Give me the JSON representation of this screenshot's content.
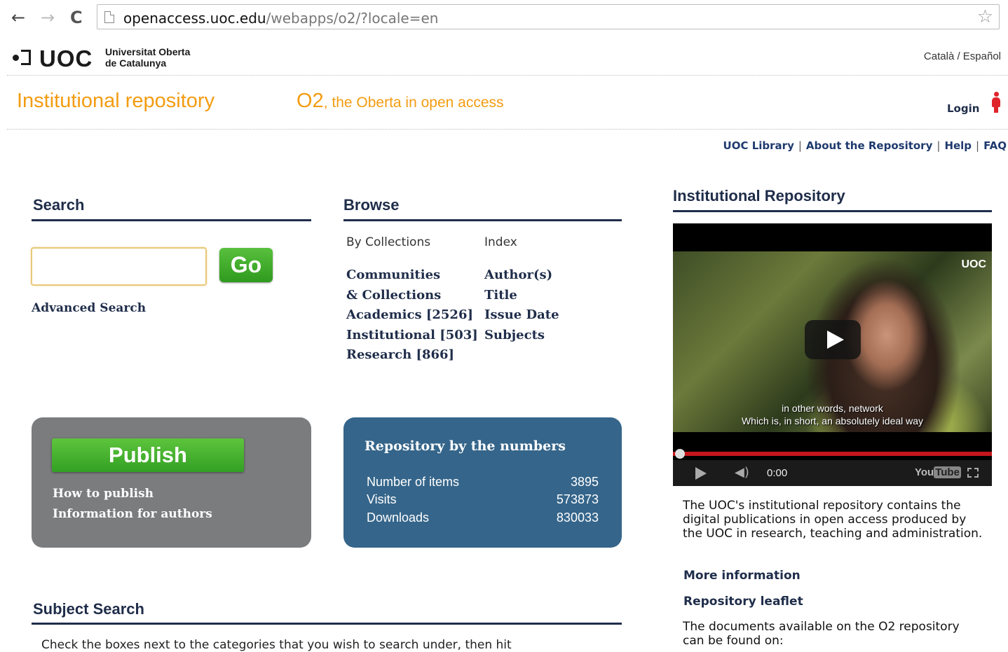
{
  "browser": {
    "url_host": "openaccess.uoc.edu",
    "url_path": "/webapps/o2/?locale=en",
    "back_glyph": "←",
    "forward_glyph": "→",
    "reload_glyph": "C",
    "star_glyph": "☆"
  },
  "header": {
    "logo_text": "UOC",
    "university_line1": "Universitat Oberta",
    "university_line2": "de Catalunya",
    "languages": "Català  / Español",
    "site_title": "Institutional repository",
    "tagline_o2": "O2",
    "tagline_rest": ", the Oberta in open access",
    "login": "Login"
  },
  "top_links": [
    "UOC Library",
    "About the Repository",
    "Help",
    "FAQ"
  ],
  "search": {
    "heading": "Search",
    "input_value": "",
    "go_label": "Go",
    "advanced_label": "Advanced Search"
  },
  "browse": {
    "heading": "Browse",
    "col1_heading": "By Collections",
    "col2_heading": "Index",
    "collections": [
      "Communities",
      "& Collections",
      "Academics [2526]",
      "Institutional [503]",
      "Research [866]"
    ],
    "index": [
      "Author(s)",
      "Title",
      "Issue Date",
      "Subjects"
    ]
  },
  "publish": {
    "button_label": "Publish",
    "links": [
      "How to publish",
      "Information for authors"
    ]
  },
  "numbers": {
    "title": "Repository by the numbers",
    "rows": [
      {
        "label": "Number of items",
        "value": "3895"
      },
      {
        "label": "Visits",
        "value": "573873"
      },
      {
        "label": "Downloads",
        "value": "830033"
      }
    ]
  },
  "subject_search": {
    "heading": "Subject Search",
    "description": "Check the boxes next to the categories that you wish to search under, then hit"
  },
  "right": {
    "heading": "Institutional Repository",
    "video": {
      "logo": "UOC",
      "caption_line1": "in other words, network",
      "caption_line2": "Which is, in short, an absolutely ideal way",
      "time": "0:00",
      "brand_you": "You",
      "brand_tube": "Tube",
      "progress": 0
    },
    "description": "The UOC's institutional repository contains the digital publications in open access produced by the UOC in research, teaching and administration.",
    "more_info": "More information",
    "leaflet": "Repository leaflet",
    "docs_text": "The documents available on the O2 repository can be found on:"
  }
}
